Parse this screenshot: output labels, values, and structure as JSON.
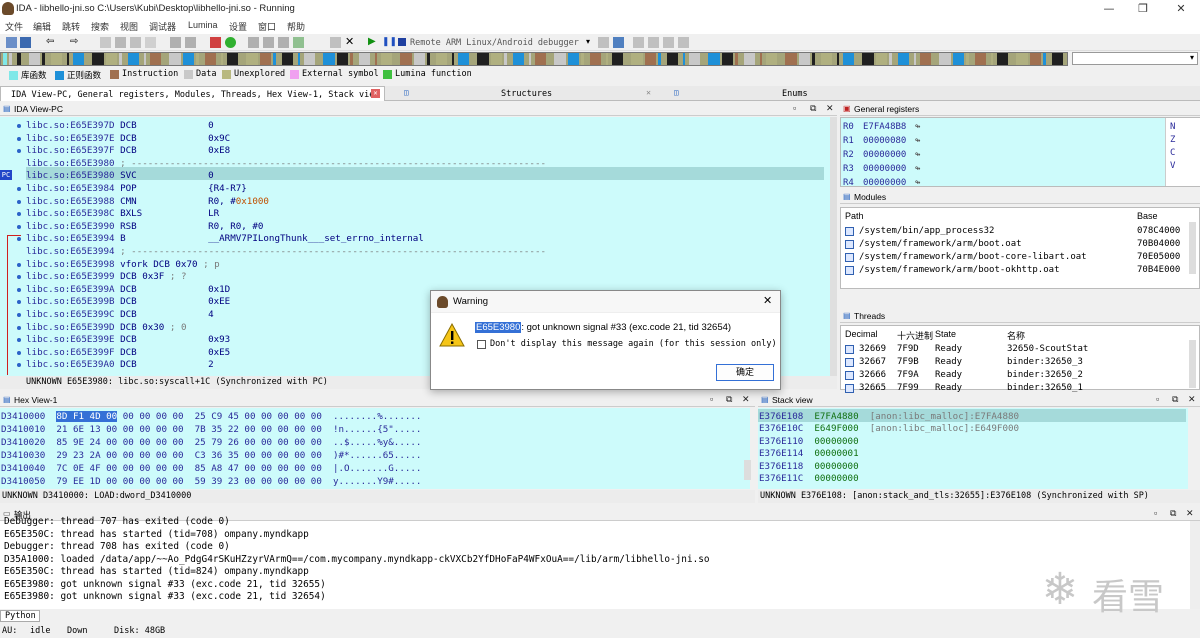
{
  "window": {
    "title": "IDA - libhello-jni.so C:\\Users\\Kubi\\Desktop\\libhello-jni.so - Running"
  },
  "menu": [
    "文件",
    "编辑",
    "跳转",
    "搜索",
    "视图",
    "调试器",
    "Lumina",
    "设置",
    "窗口",
    "帮助"
  ],
  "toolbar": {
    "debugger": "Remote ARM Linux/Android debugger"
  },
  "legend": [
    {
      "label": "库函数",
      "color": "#80e8e8"
    },
    {
      "label": "正则函数",
      "color": "#1e90d8"
    },
    {
      "label": "Instruction",
      "color": "#a07050"
    },
    {
      "label": "Data",
      "color": "#c8c8c8"
    },
    {
      "label": "Unexplored",
      "color": "#b8b880"
    },
    {
      "label": "External symbol",
      "color": "#f0a0f0"
    },
    {
      "label": "Lumina function",
      "color": "#40c040"
    }
  ],
  "tabs": {
    "main": "IDA View-PC, General registers, Modules, Threads, Hex View-1, Stack view",
    "structures": "Structures",
    "enums": "Enums"
  },
  "ida": {
    "title": "IDA View-PC",
    "lines": [
      {
        "a": "libc.so:E65E397D",
        "m": "DCB",
        "o": "0"
      },
      {
        "a": "libc.so:E65E397E",
        "m": "DCB",
        "o": "0x9C"
      },
      {
        "a": "libc.so:E65E397F",
        "m": "DCB",
        "o": "0xE8"
      },
      {
        "a": "libc.so:E65E3980",
        "m": ";",
        "o": "---------------------------------------------------------------------------"
      },
      {
        "a": "libc.so:E65E3980",
        "m": "SVC",
        "o": "0"
      },
      {
        "a": "libc.so:E65E3984",
        "m": "POP",
        "o": "{R4-R7}"
      },
      {
        "a": "libc.so:E65E3988",
        "m": "CMN",
        "o": "R0, #",
        "n": "0x1000"
      },
      {
        "a": "libc.so:E65E398C",
        "m": "BXLS",
        "o": "LR"
      },
      {
        "a": "libc.so:E65E3990",
        "m": "RSB",
        "o": "R0, R0, #0"
      },
      {
        "a": "libc.so:E65E3994",
        "m": "B",
        "o": "__ARMV7PILongThunk___set_errno_internal"
      },
      {
        "a": "libc.so:E65E3994",
        "m": ";",
        "o": "---------------------------------------------------------------------------"
      },
      {
        "a": "libc.so:E65E3998",
        "m": "vfork DCB 0x70",
        "c": "; p"
      },
      {
        "a": "libc.so:E65E3999",
        "m": "DCB 0x3F",
        "c": "; ?"
      },
      {
        "a": "libc.so:E65E399A",
        "m": "DCB",
        "o": "0x1D"
      },
      {
        "a": "libc.so:E65E399B",
        "m": "DCB",
        "o": "0xEE"
      },
      {
        "a": "libc.so:E65E399C",
        "m": "DCB",
        "o": "4"
      },
      {
        "a": "libc.so:E65E399D",
        "m": "DCB 0x30",
        "c": "; 0"
      },
      {
        "a": "libc.so:E65E399E",
        "m": "DCB",
        "o": "0x93"
      },
      {
        "a": "libc.so:E65E399F",
        "m": "DCB",
        "o": "0xE5"
      },
      {
        "a": "libc.so:E65E39A0",
        "m": "DCB",
        "o": "2"
      }
    ],
    "status": "UNKNOWN E65E3980: libc.so:syscall+1C (Synchronized with PC)",
    "pc": "PC"
  },
  "registers": {
    "title": "General registers",
    "rows": [
      [
        "R0",
        "E7FA48B8"
      ],
      [
        "R1",
        "00000080"
      ],
      [
        "R2",
        "00000000"
      ],
      [
        "R3",
        "00000000"
      ],
      [
        "R4",
        "00000000"
      ]
    ],
    "flags": [
      "N",
      "Z",
      "C",
      "V"
    ]
  },
  "modules": {
    "title": "Modules",
    "headers": [
      "Path",
      "Base"
    ],
    "rows": [
      [
        "/system/bin/app_process32",
        "078C4000"
      ],
      [
        "/system/framework/arm/boot.oat",
        "70B04000"
      ],
      [
        "/system/framework/arm/boot-core-libart.oat",
        "70E05000"
      ],
      [
        "/system/framework/arm/boot-okhttp.oat",
        "70B4E000"
      ]
    ]
  },
  "threads": {
    "title": "Threads",
    "headers": [
      "Decimal",
      "十六进制",
      "State",
      "名称"
    ],
    "rows": [
      [
        "32669",
        "7F9D",
        "Ready",
        "32650-ScoutStat"
      ],
      [
        "32667",
        "7F9B",
        "Ready",
        "binder:32650_3"
      ],
      [
        "32666",
        "7F9A",
        "Ready",
        "binder:32650_2"
      ],
      [
        "32665",
        "7F99",
        "Ready",
        "binder:32650_1"
      ]
    ]
  },
  "dialog": {
    "title": "Warning",
    "addr": "E65E3980",
    "message": ": got unknown signal #33 (exc.code 21, tid 32654)",
    "checkbox": "Don't display this message again (for this session only)",
    "ok": "确定"
  },
  "hex": {
    "title": "Hex View-1",
    "rows": [
      {
        "a": "D3410000",
        "sel": "8D F1 4D 00",
        "b": " 00 00 00 00  25 C9 45 00 00 00 00 00",
        "t": "........%......."
      },
      {
        "a": "D3410010",
        "b": "21 6E 13 00 00 00 00 00  7B 35 22 00 00 00 00 00",
        "t": "!n......{5\"....."
      },
      {
        "a": "D3410020",
        "b": "85 9E 24 00 00 00 00 00  25 79 26 00 00 00 00 00",
        "t": "..$.....%y&....."
      },
      {
        "a": "D3410030",
        "b": "29 23 2A 00 00 00 00 00  C3 36 35 00 00 00 00 00",
        "t": ")#*......65....."
      },
      {
        "a": "D3410040",
        "b": "7C 0E 4F 00 00 00 00 00  85 A8 47 00 00 00 00 00",
        "t": "|.O.......G....."
      },
      {
        "a": "D3410050",
        "b": "79 EE 1D 00 00 00 00 00  59 39 23 00 00 00 00 00",
        "t": "y.......Y9#....."
      }
    ],
    "status": "UNKNOWN D3410000: LOAD:dword_D3410000"
  },
  "stack": {
    "title": "Stack view",
    "rows": [
      {
        "a": "E376E108",
        "v": "E7FA4880",
        "c": "[anon:libc_malloc]:E7FA4880"
      },
      {
        "a": "E376E10C",
        "v": "E649F000",
        "c": "[anon:libc_malloc]:E649F000"
      },
      {
        "a": "E376E110",
        "v": "00000000",
        "c": ""
      },
      {
        "a": "E376E114",
        "v": "00000001",
        "c": ""
      },
      {
        "a": "E376E118",
        "v": "00000000",
        "c": ""
      },
      {
        "a": "E376E11C",
        "v": "00000000",
        "c": ""
      }
    ],
    "status": "UNKNOWN E376E108: [anon:stack_and_tls:32655]:E376E108 (Synchronized with SP)"
  },
  "output": {
    "title": "输出",
    "lines": [
      "Debugger: thread 707 has exited (code 0)",
      "E65E350C: thread has started (tid=708) ompany.myndkapp",
      "Debugger: thread 708 has exited (code 0)",
      "D35A1000: loaded /data/app/~~Ao_PdgG4rSKuHZzyrVArmQ==/com.mycompany.myndkapp-ckVXCb2YfDHoFaP4WFxOuA==/lib/arm/libhello-jni.so",
      "E65E350C: thread has started (tid=824) ompany.myndkapp",
      "E65E3980: got unknown signal #33 (exc.code 21, tid 32655)",
      "E65E3980: got unknown signal #33 (exc.code 21, tid 32654)"
    ],
    "lang": "Python"
  },
  "status": {
    "mode": "AU:",
    "state": "idle",
    "dir": "Down",
    "disk": "Disk: 48GB"
  },
  "watermark": "看雪"
}
